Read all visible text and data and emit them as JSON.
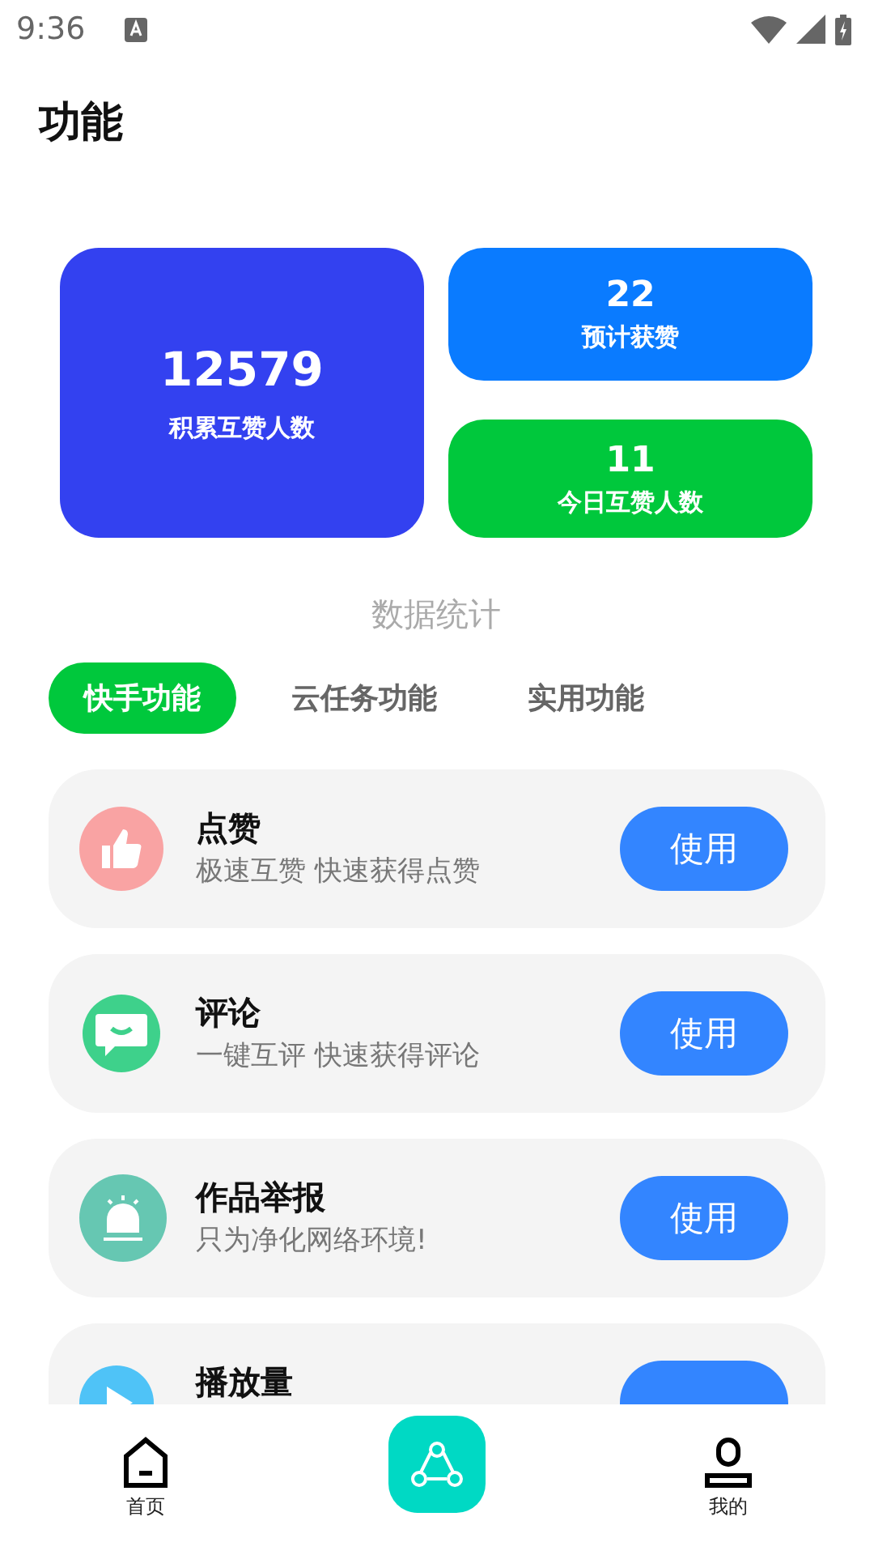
{
  "status_bar": {
    "time": "9:36"
  },
  "header": {
    "title": "功能"
  },
  "stats": [
    {
      "value": "12579",
      "label": "积累互赞人数",
      "color": "#3341f0"
    },
    {
      "value": "22",
      "label": "预计获赞",
      "color": "#0a7bff"
    },
    {
      "value": "11",
      "label": "今日互赞人数",
      "color": "#00c83c"
    }
  ],
  "stats_caption": "数据统计",
  "tabs": [
    {
      "label": "快手功能",
      "selected": true
    },
    {
      "label": "云任务功能",
      "selected": false
    },
    {
      "label": "实用功能",
      "selected": false
    }
  ],
  "features": [
    {
      "kind": "like",
      "title": "点赞",
      "subtitle": "极速互赞 快速获得点赞",
      "button": "使用"
    },
    {
      "kind": "comment",
      "title": "评论",
      "subtitle": "一键互评 快速获得评论",
      "button": "使用"
    },
    {
      "kind": "report",
      "title": "作品举报",
      "subtitle": "只为净化网络环境!",
      "button": "使用"
    },
    {
      "kind": "play",
      "title": "播放量"
    }
  ],
  "nav": [
    {
      "kind": "home",
      "label": "首页"
    },
    {
      "kind": "center"
    },
    {
      "kind": "profile",
      "label": "我的"
    }
  ]
}
